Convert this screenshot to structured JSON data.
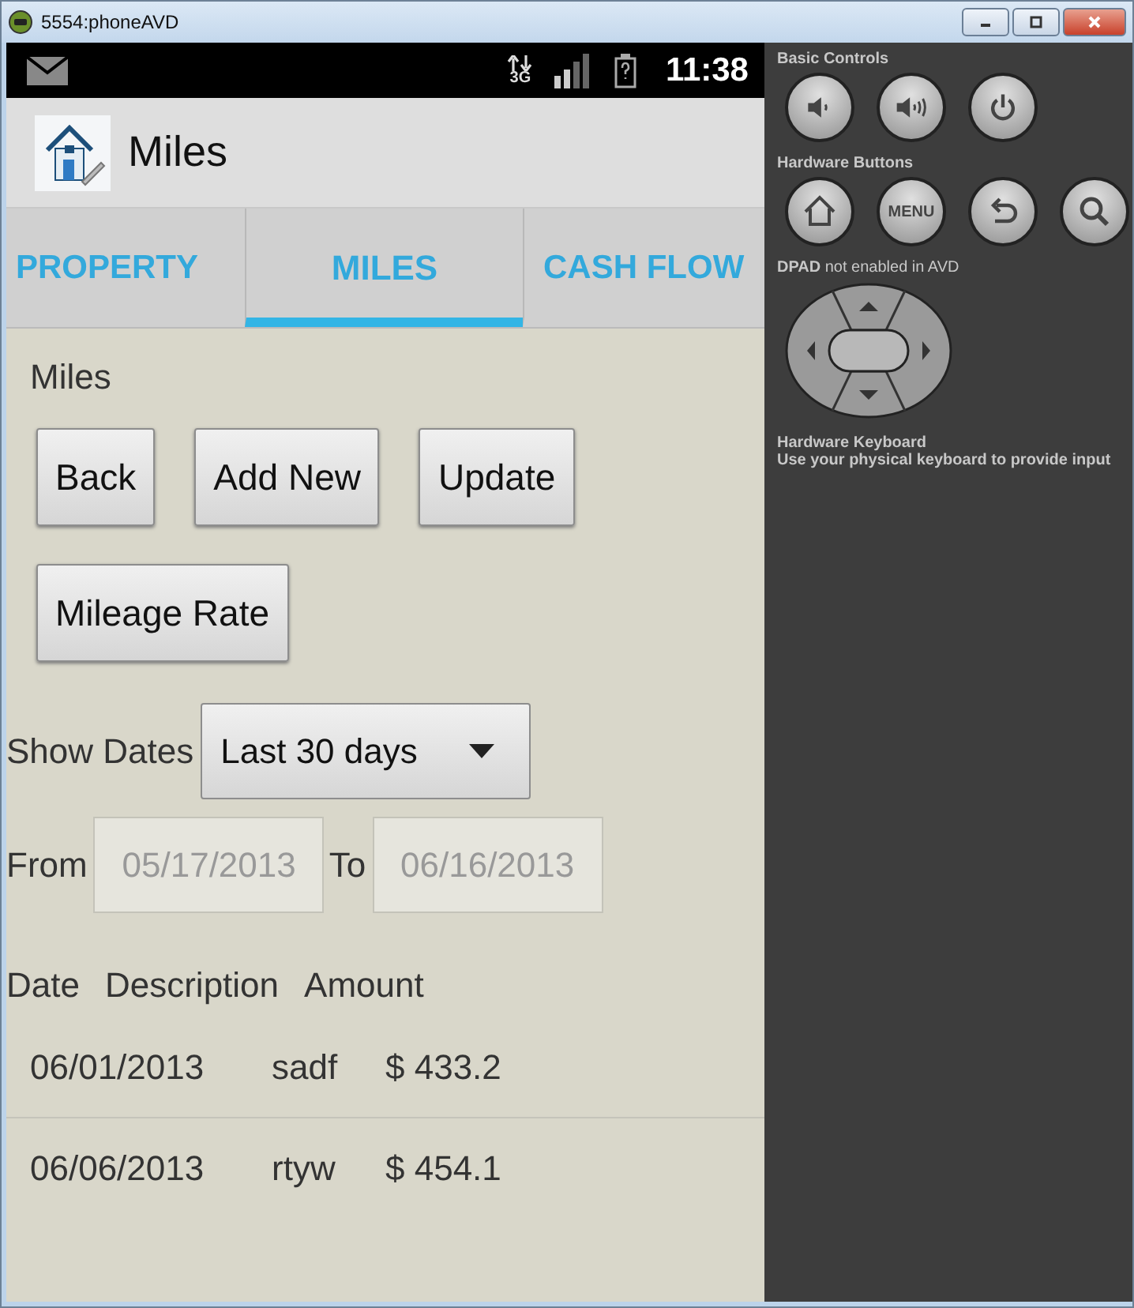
{
  "window": {
    "title": "5554:phoneAVD"
  },
  "status_bar": {
    "network": "3G",
    "time": "11:38"
  },
  "action_bar": {
    "title": "Miles"
  },
  "tabs": [
    {
      "label": "PROPERTY",
      "selected": false
    },
    {
      "label": "MILES",
      "selected": true
    },
    {
      "label": "CASH FLOW",
      "selected": false
    }
  ],
  "section_title": "Miles",
  "buttons": [
    "Back",
    "Add New",
    "Update",
    "Mileage Rate"
  ],
  "date_filter": {
    "label": "Show Dates",
    "value": "Last 30 days"
  },
  "date_range": {
    "from_label": "From",
    "from": "05/17/2013",
    "to_label": "To",
    "to": "06/16/2013"
  },
  "table": {
    "columns": [
      "Date",
      "Description",
      "Amount"
    ],
    "rows": [
      [
        "06/01/2013",
        "sadf",
        "$ 433.2"
      ],
      [
        "06/06/2013",
        "rtyw",
        "$ 454.1"
      ]
    ]
  },
  "controls": {
    "basic_title": "Basic Controls",
    "hardware_title": "Hardware Buttons",
    "menu_label": "MENU",
    "dpad_note": "**DPAD** not enabled in AVD",
    "keyboard_title": "Hardware Keyboard",
    "keyboard_note": "Use your physical keyboard to provide input"
  }
}
